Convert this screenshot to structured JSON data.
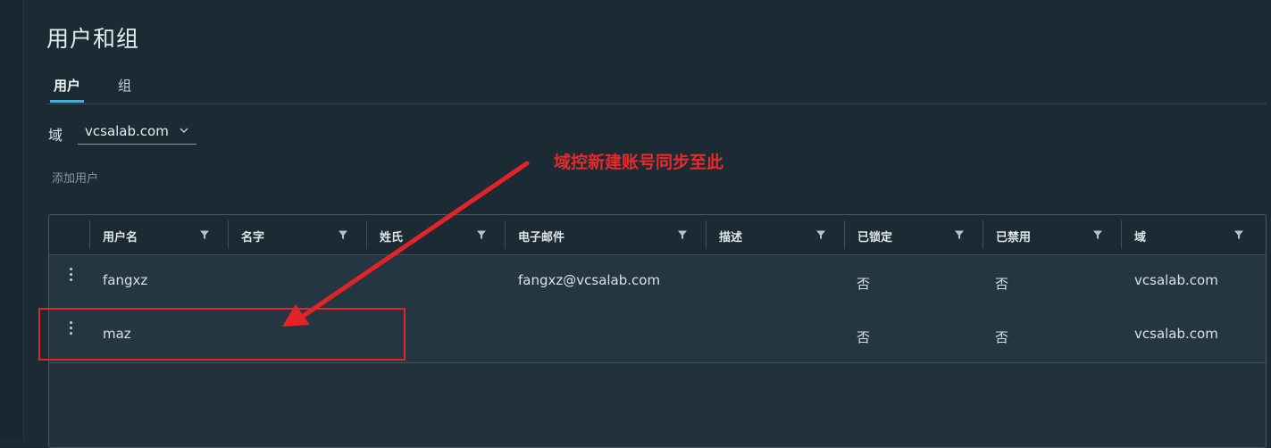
{
  "page": {
    "title": "用户和组"
  },
  "tabs": [
    {
      "label": "用户",
      "active": true
    },
    {
      "label": "组",
      "active": false
    }
  ],
  "domain_filter": {
    "label": "域",
    "value": "vcsalab.com"
  },
  "add_user_label": "添加用户",
  "table": {
    "columns": [
      "用户名",
      "名字",
      "姓氏",
      "电子邮件",
      "描述",
      "已锁定",
      "已禁用",
      "域"
    ],
    "rows": [
      [
        "fangxz",
        "",
        "",
        "fangxz@vcsalab.com",
        "",
        "否",
        "否",
        "vcsalab.com"
      ],
      [
        "maz",
        "",
        "",
        "",
        "",
        "否",
        "否",
        "vcsalab.com"
      ]
    ]
  },
  "annotation": {
    "text": "域控新建账号同步至此",
    "color": "#e52a2a"
  },
  "colors": {
    "background": "#1b2a33",
    "accent": "#49afd9",
    "annotation": "#e2232a"
  }
}
